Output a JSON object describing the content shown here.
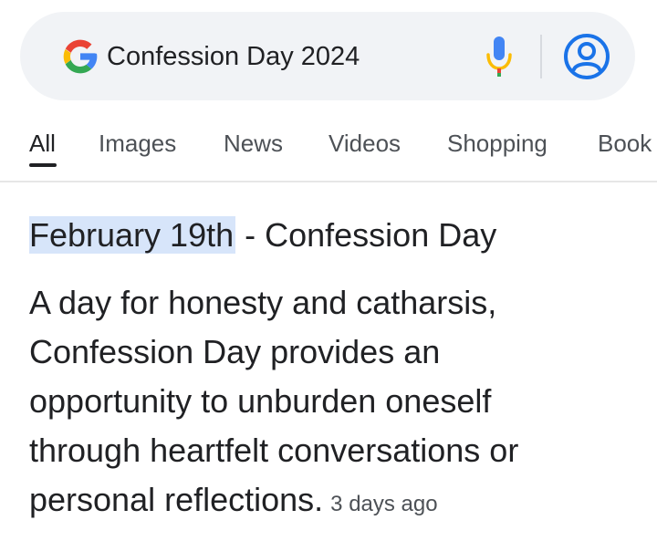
{
  "search": {
    "query": "Confession Day 2024"
  },
  "icons": {
    "logo": "google-g-icon",
    "mic": "microphone-icon",
    "account": "account-circle-icon"
  },
  "colors": {
    "google_blue": "#4285F4",
    "google_red": "#EA4335",
    "google_yellow": "#FBBC05",
    "google_green": "#34A853",
    "highlight": "#D7E5FA",
    "search_bar_bg": "#F1F3F6"
  },
  "tabs": [
    {
      "label": "All",
      "active": true
    },
    {
      "label": "Images",
      "active": false
    },
    {
      "label": "News",
      "active": false
    },
    {
      "label": "Videos",
      "active": false
    },
    {
      "label": "Shopping",
      "active": false
    },
    {
      "label": "Book",
      "active": false
    }
  ],
  "result": {
    "heading_highlight": "February 19th",
    "heading_rest": " - Confession Day",
    "body_lines": [
      "A day for honesty and catharsis,",
      "Confession Day provides an",
      "opportunity to unburden oneself",
      "through heartfelt conversations or",
      "personal reflections."
    ],
    "timestamp": "3 days ago"
  }
}
